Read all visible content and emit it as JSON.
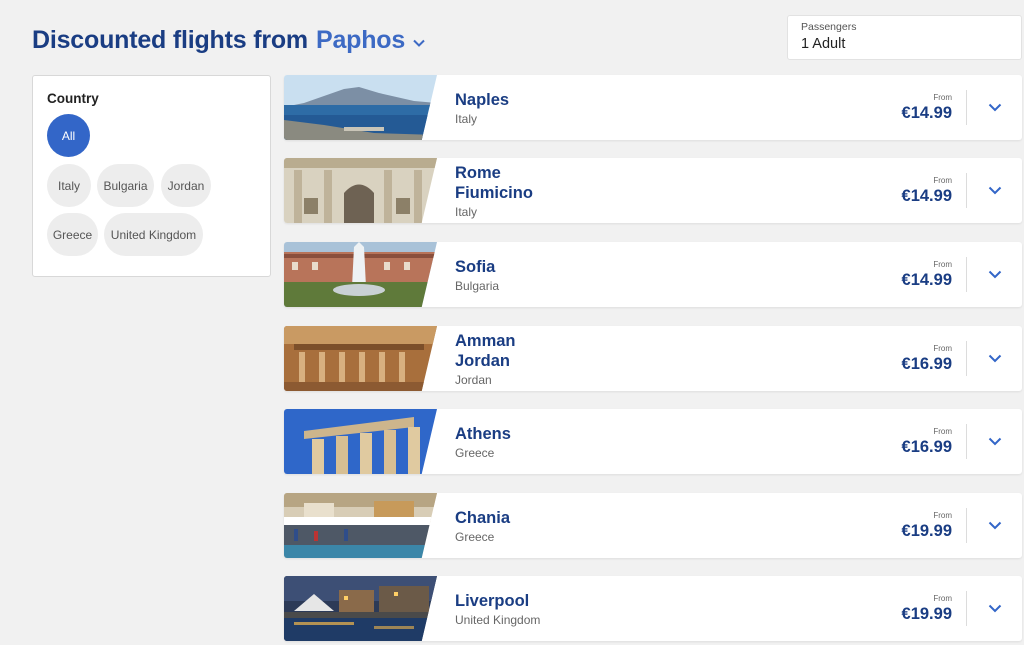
{
  "header": {
    "title": "Discounted flights from",
    "origin": "Paphos"
  },
  "passengers": {
    "label": "Passengers",
    "value": "1 Adult"
  },
  "filter": {
    "title": "Country",
    "chips": [
      "All",
      "Italy",
      "Bulgaria",
      "Jordan",
      "Greece",
      "United Kingdom"
    ],
    "selected": "All"
  },
  "price_label": "From",
  "flights": [
    {
      "city": "Naples",
      "country": "Italy",
      "price": "€14.99",
      "image": "naples-bay-photo"
    },
    {
      "city": "Rome Fiumicino",
      "country": "Italy",
      "price": "€14.99",
      "image": "rome-building-photo"
    },
    {
      "city": "Sofia",
      "country": "Bulgaria",
      "price": "€14.99",
      "image": "sofia-fountain-photo"
    },
    {
      "city": "Amman Jordan",
      "country": "Jordan",
      "price": "€16.99",
      "image": "amman-ruins-photo"
    },
    {
      "city": "Athens",
      "country": "Greece",
      "price": "€16.99",
      "image": "athens-parthenon-photo"
    },
    {
      "city": "Chania",
      "country": "Greece",
      "price": "€19.99",
      "image": "chania-harbour-photo"
    },
    {
      "city": "Liverpool",
      "country": "United Kingdom",
      "price": "€19.99",
      "image": "liverpool-waterfront-photo"
    }
  ],
  "colors": {
    "brand_blue": "#1a3d83",
    "accent_blue": "#3366c8",
    "background": "#f1f1f1"
  }
}
